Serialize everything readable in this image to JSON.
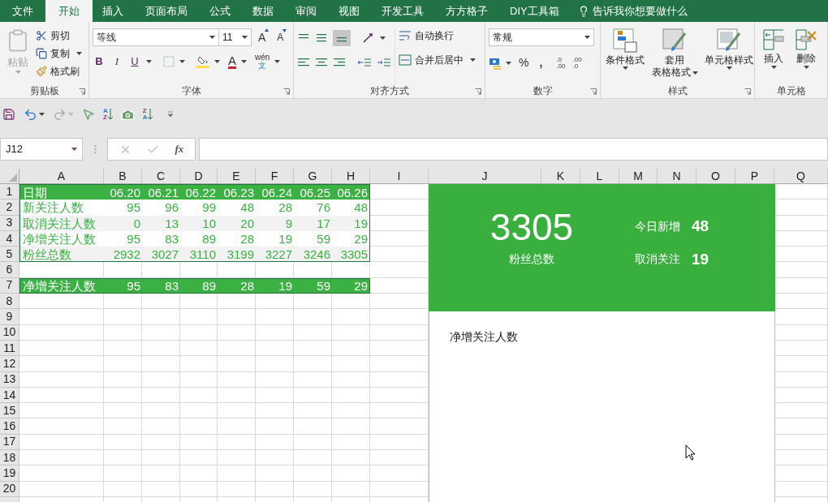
{
  "ribbon_tabs": [
    {
      "label": "文件",
      "selected": false
    },
    {
      "label": "开始",
      "selected": true
    },
    {
      "label": "插入",
      "selected": false
    },
    {
      "label": "页面布局",
      "selected": false
    },
    {
      "label": "公式",
      "selected": false
    },
    {
      "label": "数据",
      "selected": false
    },
    {
      "label": "审阅",
      "selected": false
    },
    {
      "label": "视图",
      "selected": false
    },
    {
      "label": "开发工具",
      "selected": false
    },
    {
      "label": "方方格子",
      "selected": false
    },
    {
      "label": "DIY工具箱",
      "selected": false
    }
  ],
  "tell_me": "告诉我你想要做什么",
  "clipboard": {
    "paste": "粘贴",
    "paste_disabled": true,
    "cut": "剪切",
    "copy": "复制",
    "format_painter": "格式刷",
    "label": "剪贴板"
  },
  "font": {
    "name": "等线",
    "size": "11",
    "grow": "A",
    "shrink": "A",
    "bold": "B",
    "italic": "I",
    "underline": "U",
    "font_color": "A",
    "phonetic_top": "wén",
    "phonetic_bottom": "文",
    "label": "字体"
  },
  "alignment": {
    "wrap_text": "自动换行",
    "merge_center": "合并后居中",
    "label": "对齐方式"
  },
  "number": {
    "format": "常规",
    "percent": "%",
    "comma": ",",
    "increase_decimal": [
      ".0",
      ".00"
    ],
    "decrease_decimal": [
      ".00",
      ".0"
    ],
    "label": "数字"
  },
  "styles": {
    "conditional": "条件格式",
    "table_format": [
      "套用",
      "表格格式"
    ],
    "cell_styles": "单元格样式",
    "label": "样式"
  },
  "cells": {
    "insert": "插入",
    "delete": "删除",
    "label": "单元格"
  },
  "quick_access": {
    "sort_ascending": [
      "A",
      "Z"
    ],
    "sort_descending": [
      "Z",
      "A"
    ]
  },
  "formula_bar": {
    "name_box": "J12",
    "fx": "fx"
  },
  "sheet": {
    "columns": [
      "A",
      "B",
      "C",
      "D",
      "E",
      "F",
      "G",
      "H",
      "I",
      "J",
      "K",
      "L",
      "M",
      "N",
      "O",
      "P",
      "Q"
    ],
    "rows": [
      {
        "number": "1",
        "kind": "header",
        "cells": [
          "日期",
          "06.20",
          "06.21",
          "06.22",
          "06.23",
          "06.24",
          "06.25",
          "06.26"
        ]
      },
      {
        "number": "2",
        "kind": "row",
        "cells": [
          "新关注人数",
          "95",
          "96",
          "99",
          "48",
          "28",
          "76",
          "48"
        ]
      },
      {
        "number": "3",
        "kind": "banded_row",
        "cells": [
          "取消关注人数",
          "0",
          "13",
          "10",
          "20",
          "9",
          "17",
          "19"
        ]
      },
      {
        "number": "4",
        "kind": "row",
        "cells": [
          "净增关注人数",
          "95",
          "83",
          "89",
          "28",
          "19",
          "59",
          "29"
        ]
      },
      {
        "number": "5",
        "kind": "banded_row",
        "cells": [
          "粉丝总数",
          "2932",
          "3027",
          "3110",
          "3199",
          "3227",
          "3246",
          "3305"
        ]
      },
      {
        "number": "6",
        "kind": "blank"
      },
      {
        "number": "7",
        "kind": "total",
        "cells": [
          "净增关注人数",
          "95",
          "83",
          "89",
          "28",
          "19",
          "59",
          "29"
        ]
      },
      {
        "number": "8",
        "kind": "blank"
      },
      {
        "number": "9",
        "kind": "blank"
      },
      {
        "number": "10",
        "kind": "blank"
      },
      {
        "number": "11",
        "kind": "blank"
      },
      {
        "number": "12",
        "kind": "blank"
      },
      {
        "number": "13",
        "kind": "blank"
      },
      {
        "number": "14",
        "kind": "blank"
      },
      {
        "number": "15",
        "kind": "blank"
      },
      {
        "number": "16",
        "kind": "blank"
      },
      {
        "number": "17",
        "kind": "blank"
      },
      {
        "number": "18",
        "kind": "blank"
      },
      {
        "number": "19",
        "kind": "blank"
      },
      {
        "number": "20",
        "kind": "blank"
      },
      {
        "kind": "blank"
      }
    ]
  },
  "dashboard": {
    "total": "3305",
    "total_label": "粉丝总数",
    "stats": [
      {
        "label": "今日新增",
        "value": "48"
      },
      {
        "label": "取消关注",
        "value": "19"
      }
    ],
    "chart_title": "净增关注人数"
  }
}
